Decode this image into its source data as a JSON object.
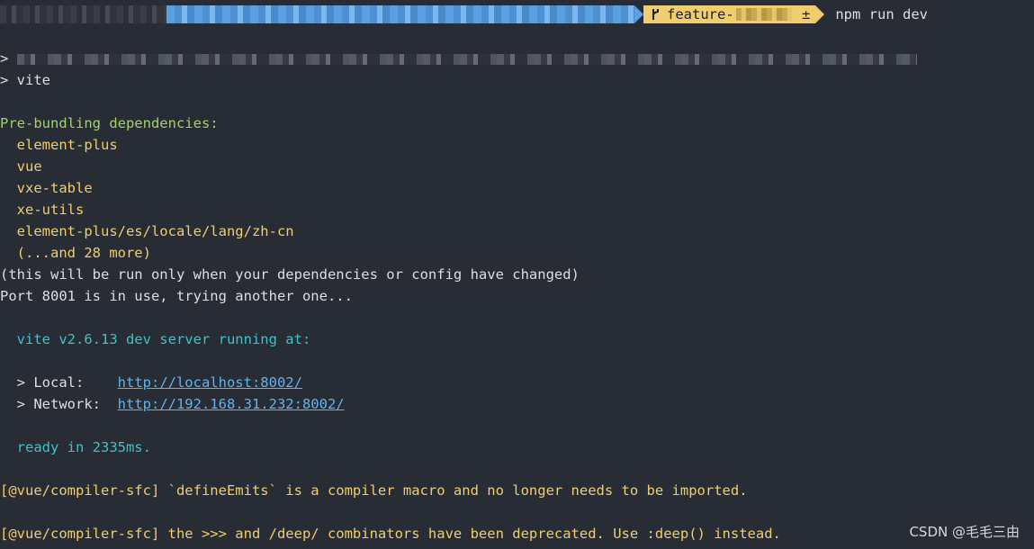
{
  "prompt": {
    "branch_prefix": "feature-",
    "branch_suffix": " ±",
    "branch_icon": "git-branch-icon",
    "command": "npm run dev"
  },
  "output": {
    "line_script_marker": "> ",
    "line_vite": "> vite",
    "prebundle_header": "Pre-bundling dependencies:",
    "deps": [
      "  element-plus",
      "  vue",
      "  vxe-table",
      "  xe-utils",
      "  element-plus/es/locale/lang/zh-cn",
      "  (...and 28 more)"
    ],
    "run_once_note": "(this will be run only when your dependencies or config have changed)",
    "port_note": "Port 8001 is in use, trying another one...",
    "server_running": "  vite v2.6.13 dev server running at:",
    "local_label": "  > Local:    ",
    "local_url": "http://localhost:8002/",
    "network_label": "  > Network:  ",
    "network_url": "http://192.168.31.232:8002/",
    "ready": "  ready in 2335ms.",
    "warn1": "[@vue/compiler-sfc] `defineEmits` is a compiler macro and no longer needs to be imported.",
    "warn2": "[@vue/compiler-sfc] the >>> and /deep/ combinators have been deprecated. Use :deep() instead."
  },
  "watermark": "CSDN @毛毛三由",
  "colors": {
    "background": "#282c35",
    "green": "#a5d06f",
    "yellow": "#f0cd6f",
    "cyan": "#3fc2c9",
    "link": "#5fb4f2"
  }
}
